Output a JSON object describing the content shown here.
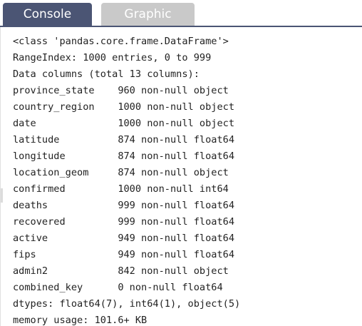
{
  "tabs": [
    {
      "label": "Console",
      "active": true
    },
    {
      "label": "Graphic",
      "active": false
    }
  ],
  "colors": {
    "active_tab": "#4b5574",
    "inactive_tab": "#c9c9c9",
    "tab_text": "#ffffff",
    "console_text": "#222222"
  },
  "console": {
    "lines": [
      "<class 'pandas.core.frame.DataFrame'>",
      "RangeIndex: 1000 entries, 0 to 999",
      "Data columns (total 13 columns):",
      "province_state    960 non-null object",
      "country_region    1000 non-null object",
      "date              1000 non-null object",
      "latitude          874 non-null float64",
      "longitude         874 non-null float64",
      "location_geom     874 non-null object",
      "confirmed         1000 non-null int64",
      "deaths            999 non-null float64",
      "recovered         999 non-null float64",
      "active            949 non-null float64",
      "fips              949 non-null float64",
      "admin2            842 non-null object",
      "combined_key      0 non-null float64",
      "dtypes: float64(7), int64(1), object(5)",
      "memory usage: 101.6+ KB"
    ]
  }
}
